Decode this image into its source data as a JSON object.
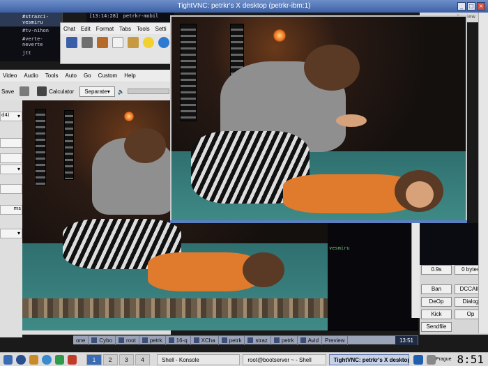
{
  "vnc": {
    "title": "TightVNC: petrkr's X desktop (petrkr-ibm:1)"
  },
  "irc": {
    "channels": [
      "#strazci-vesmiru",
      "#tv-nihon",
      "#verte-neverte",
      "jtt"
    ],
    "active_index": 0,
    "top_time": "[13:14:28]",
    "top_nick": "petrkr-mobil",
    "right_top": "Preview",
    "panel_channel": "vesmiru",
    "stats": {
      "time": "0.9s",
      "bytes": "0 bytes"
    },
    "buttons": [
      "Ban",
      "DCCAllo",
      "DeOp",
      "Dialog",
      "Kick",
      "Op",
      "Sendfile"
    ]
  },
  "chat_window": {
    "menu": [
      "Chat",
      "Edit",
      "Format",
      "Tabs",
      "Tools",
      "Setti"
    ]
  },
  "player": {
    "menu": [
      "Video",
      "Audio",
      "Tools",
      "Auto",
      "Go",
      "Custom",
      "Help"
    ],
    "toolbar": {
      "save": "Save",
      "calculator": "Calculator",
      "separate": "Separate"
    },
    "side": {
      "field1": "d4)",
      "field2": "ms"
    }
  },
  "remote_taskbar": {
    "desk": "one",
    "items": [
      "Cybo",
      "root",
      "petrk",
      "16-q",
      "XCha",
      "petrk",
      "straz",
      "petrk",
      "Avid",
      "Preview"
    ],
    "clock": "13:51"
  },
  "local_panel": {
    "desktops": [
      "1",
      "2",
      "3",
      "4"
    ],
    "active_desktop": 0,
    "tasks": [
      "Shell - Konsole",
      "root@bootserver ~ - Shell",
      "TightVNC: petrkr's X desktop"
    ],
    "active_task": 2,
    "city": "Prague",
    "clock": "8:51"
  },
  "colors": {
    "titlebar": "#3c60a6",
    "accent": "#3a6bb5",
    "floor": "#3f8a86",
    "dress": "#e07a2c"
  }
}
